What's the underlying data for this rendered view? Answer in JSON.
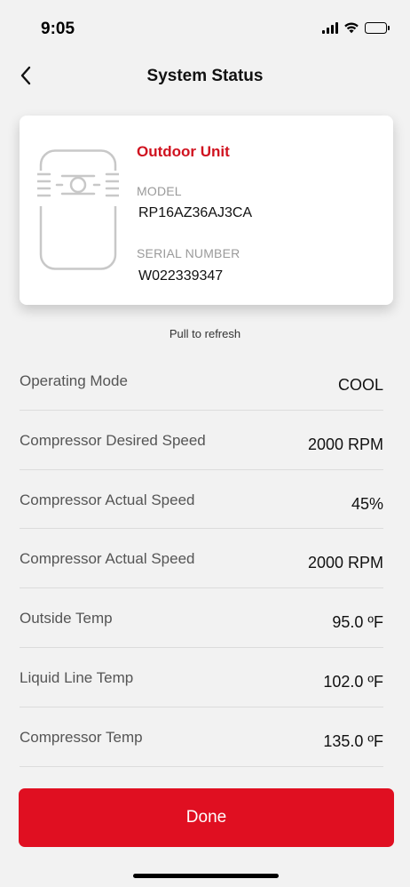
{
  "status_bar": {
    "time": "9:05"
  },
  "nav": {
    "title": "System Status",
    "back_icon": "chevron-left-icon"
  },
  "device": {
    "name": "Outdoor Unit",
    "model_label": "MODEL",
    "model": "RP16AZ36AJ3CA",
    "serial_label": "SERIAL NUMBER",
    "serial": "W022339347",
    "accent_color": "#d0121f"
  },
  "pull_to_refresh": "Pull to refresh",
  "rows": [
    {
      "label": "Operating Mode",
      "value": "COOL"
    },
    {
      "label": "Compressor Desired Speed",
      "value": "2000 RPM"
    },
    {
      "label": "Compressor Actual Speed",
      "value": "45%"
    },
    {
      "label": "Compressor Actual Speed",
      "value": "2000 RPM"
    },
    {
      "label": "Outside Temp",
      "value": "95.0 ºF"
    },
    {
      "label": "Liquid Line Temp",
      "value": "102.0 ºF"
    },
    {
      "label": "Compressor Temp",
      "value": "135.0 ºF"
    }
  ],
  "done_button": {
    "label": "Done",
    "color": "#e00f21"
  }
}
